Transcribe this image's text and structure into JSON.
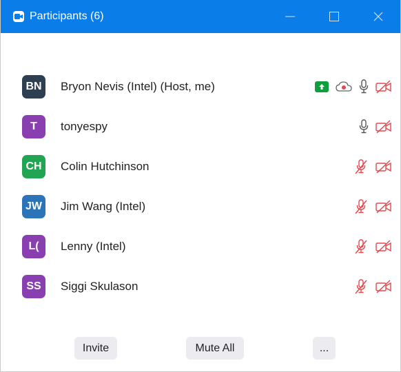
{
  "window": {
    "title": "Participants (6)"
  },
  "participants": [
    {
      "initials": "BN",
      "name": "Bryon Nevis (Intel) (Host, me)",
      "avatar_color": "#2f3f52",
      "sharing": true,
      "recording": true,
      "mic": "on",
      "video": "off"
    },
    {
      "initials": "T",
      "name": "tonyespy",
      "avatar_color": "#8a3fb0",
      "sharing": false,
      "recording": false,
      "mic": "on",
      "video": "off"
    },
    {
      "initials": "CH",
      "name": "Colin Hutchinson",
      "avatar_color": "#21a552",
      "sharing": false,
      "recording": false,
      "mic": "muted",
      "video": "off"
    },
    {
      "initials": "JW",
      "name": "Jim Wang (Intel)",
      "avatar_color": "#2b74b8",
      "sharing": false,
      "recording": false,
      "mic": "muted",
      "video": "off"
    },
    {
      "initials": "L(",
      "name": "Lenny (Intel)",
      "avatar_color": "#8a3fb0",
      "sharing": false,
      "recording": false,
      "mic": "muted",
      "video": "off"
    },
    {
      "initials": "SS",
      "name": "Siggi Skulason",
      "avatar_color": "#8a3fb0",
      "sharing": false,
      "recording": false,
      "mic": "muted",
      "video": "off"
    }
  ],
  "footer": {
    "invite_label": "Invite",
    "mute_all_label": "Mute All",
    "more_label": "..."
  },
  "colors": {
    "titlebar": "#0b7de8",
    "muted_red": "#e5484d",
    "share_green": "#0f9d3f"
  }
}
